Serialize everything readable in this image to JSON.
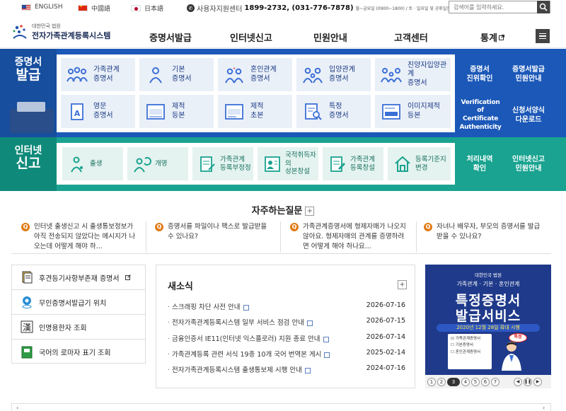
{
  "topbar": {
    "languages": [
      {
        "label": "ENGLISH",
        "icon": "us-flag-icon"
      },
      {
        "label": "中國語",
        "icon": "china-flag-icon"
      },
      {
        "label": "日本語",
        "icon": "japan-flag-icon"
      }
    ],
    "callcenter": {
      "label": "사용자지원센터",
      "numbers": "1899-2732, (031-776-7878)",
      "hours": "월~금요일 (0900~1800) / 토 · 일요일 및 공휴일은 휴무"
    },
    "search": {
      "placeholder": "검색어를 입력하세요."
    }
  },
  "header": {
    "org": "대한민국 법원",
    "system": "전자가족관계등록시스템",
    "nav": [
      "증명서발급",
      "인터넷신고",
      "민원안내",
      "고객센터",
      "통계"
    ]
  },
  "certificate": {
    "title_line1": "증명서",
    "title_line2": "발급",
    "tiles_row1": [
      {
        "line1": "가족관계",
        "line2": "증명서",
        "icon": "family-icon"
      },
      {
        "line1": "기본",
        "line2": "증명서",
        "icon": "person-icon"
      },
      {
        "line1": "혼인관계",
        "line2": "증명서",
        "icon": "couple-icon"
      },
      {
        "line1": "입양관계",
        "line2": "증명서",
        "icon": "adoption-icon"
      },
      {
        "line1": "친양자입양관계",
        "line2": "증명서",
        "icon": "family-adoption-icon"
      }
    ],
    "tiles_row2": [
      {
        "line1": "영문",
        "line2": "증명서",
        "icon": "english-document-icon"
      },
      {
        "line1": "제적",
        "line2": "등본",
        "icon": "removed-record-icon"
      },
      {
        "line1": "제적",
        "line2": "초본",
        "icon": "removed-record-excerpt-icon"
      },
      {
        "line1": "특정",
        "line2": "증명서",
        "icon": "search-document-icon"
      },
      {
        "line1": "이미지제적",
        "line2": "등본",
        "icon": "image-record-icon"
      }
    ],
    "right_links": [
      {
        "line1": "증명서",
        "line2": "진위확인"
      },
      {
        "line1": "증명서발급",
        "line2": "민원안내"
      },
      {
        "line1": "Verification of",
        "line2": "Certificate",
        "line3": "Authenticity"
      },
      {
        "line1": "신청서양식",
        "line2": "다운로드"
      }
    ]
  },
  "report": {
    "title_line1": "인터넷",
    "title_line2": "신고",
    "tiles": [
      {
        "line1": "출생",
        "line2": "",
        "icon": "birth-icon"
      },
      {
        "line1": "개명",
        "line2": "",
        "icon": "rename-icon"
      },
      {
        "line1": "가족관계",
        "line2": "등록부정정",
        "icon": "correction-icon"
      },
      {
        "line1": "국적취득자의",
        "line2": "성본창설",
        "icon": "nationality-icon"
      },
      {
        "line1": "가족관계",
        "line2": "등록창설",
        "icon": "register-creation-icon"
      },
      {
        "line1": "등록기준지",
        "line2": "변경",
        "icon": "house-icon"
      }
    ],
    "right_links": [
      {
        "line1": "처리내역",
        "line2": "확인"
      },
      {
        "line1": "인터넷신고",
        "line2": "민원안내"
      }
    ]
  },
  "faq": {
    "title": "자주하는질문",
    "items": [
      {
        "line1": "인터넷 출생신고 시 출생통보정보가",
        "line2": "아직 전송되지 않았다는 메시지가 나",
        "line3": "오는데 어떻게 해야 하..."
      },
      {
        "line1": "증명서를 파일이나 팩스로 발급받을",
        "line2": "수 있나요?",
        "line3": ""
      },
      {
        "line1": "가족관계증명서에 형제자매가 나오지",
        "line2": "않아요. 형제자매의 관계를 증명하려",
        "line3": "면 어떻게 해야 하나요..."
      },
      {
        "line1": "자녀나 배우자, 부모의 증명서를 발급",
        "line2": "받을 수 있나요?",
        "line3": ""
      }
    ]
  },
  "quicklinks": [
    {
      "label": "후견등기사항부존재 증명서",
      "icon": "document-icon"
    },
    {
      "label": "무인증명서발급기 위치",
      "icon": "location-pin-icon"
    },
    {
      "label": "인명용한자 조회",
      "icon": "hanja-icon"
    },
    {
      "label": "국어의 로마자 표기 조회",
      "icon": "green-book-icon"
    }
  ],
  "news": {
    "title": "새소식",
    "items": [
      {
        "title": "스크래핑 차단 사전 안내",
        "date": "2026-07-16"
      },
      {
        "title": "전자가족관계등록시스템 일부 서비스 점검 안내",
        "date": "2026-07-15"
      },
      {
        "title": "금융인증서 IE11(인터넷 익스플로러) 지원 종료 안내",
        "date": "2026-07-14"
      },
      {
        "title": "가족관계등록 관련 서식 19종 10개 국어 번역본 게시",
        "date": "2025-02-14"
      },
      {
        "title": "전자가족관계등록시스템 출생통보제 시행 안내",
        "date": "2024-07-16"
      }
    ]
  },
  "banner": {
    "org": "대한민국 법원",
    "subtitle": "가족관계 · 기본 · 혼인관계",
    "headline1": "특정증명서",
    "headline2": "발급서비스",
    "date": "2020년 12월 28일 확대 시행",
    "form_items": [
      "가족관계증명서",
      "기본증명서",
      "혼인관계증명서"
    ],
    "stamp": "특정",
    "pages": [
      "1",
      "2",
      "3",
      "4",
      "5",
      "6",
      "7"
    ],
    "active_page": "3"
  },
  "colors": {
    "blue_band": "#1b58b8",
    "green_band": "#19a390",
    "faq_q": "#e07b17",
    "tile_blue_text": "#1b3b85"
  }
}
